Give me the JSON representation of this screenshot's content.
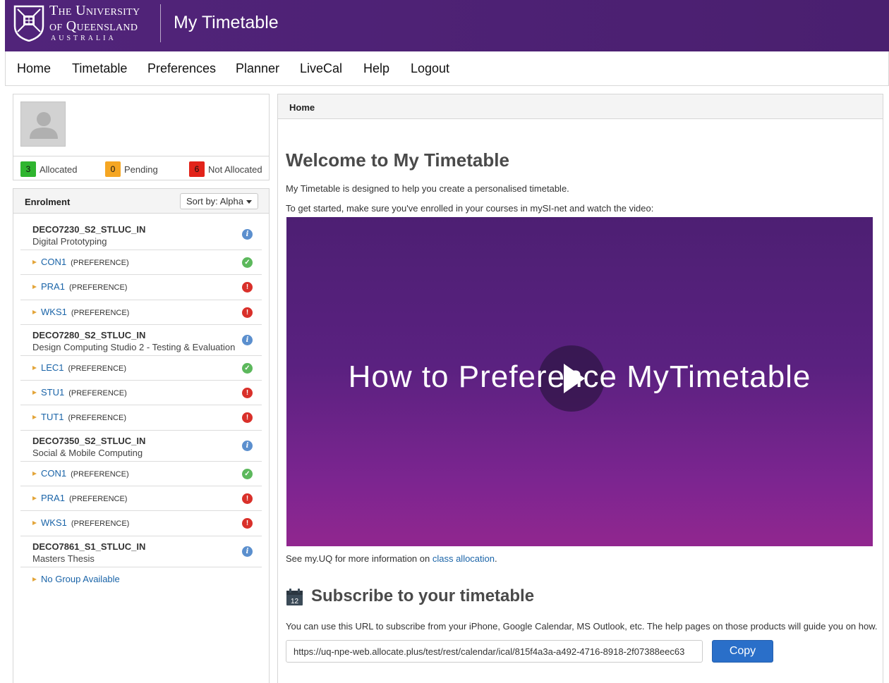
{
  "header": {
    "university_line1": "The University",
    "university_line2": "of Queensland",
    "university_country": "AUSTRALIA",
    "app_title": "My Timetable"
  },
  "nav": {
    "items": [
      "Home",
      "Timetable",
      "Preferences",
      "Planner",
      "LiveCal",
      "Help",
      "Logout"
    ]
  },
  "profile": {
    "stats": [
      {
        "count": "3",
        "label": "Allocated",
        "color": "#2fb52f"
      },
      {
        "count": "0",
        "label": "Pending",
        "color": "#f5a623"
      },
      {
        "count": "6",
        "label": "Not Allocated",
        "color": "#e2231a"
      }
    ]
  },
  "enrolment": {
    "title": "Enrolment",
    "sort_label": "Sort by: Alpha",
    "courses": [
      {
        "code": "DECO7230_S2_STLUC_IN",
        "name": "Digital Prototyping",
        "groups": [
          {
            "code": "CON1",
            "tag": "(PREFERENCE)",
            "status": "ok"
          },
          {
            "code": "PRA1",
            "tag": "(PREFERENCE)",
            "status": "error"
          },
          {
            "code": "WKS1",
            "tag": "(PREFERENCE)",
            "status": "error"
          }
        ]
      },
      {
        "code": "DECO7280_S2_STLUC_IN",
        "name": "Design Computing Studio 2 - Testing & Evaluation",
        "groups": [
          {
            "code": "LEC1",
            "tag": "(PREFERENCE)",
            "status": "ok"
          },
          {
            "code": "STU1",
            "tag": "(PREFERENCE)",
            "status": "error"
          },
          {
            "code": "TUT1",
            "tag": "(PREFERENCE)",
            "status": "error"
          }
        ]
      },
      {
        "code": "DECO7350_S2_STLUC_IN",
        "name": "Social & Mobile Computing",
        "groups": [
          {
            "code": "CON1",
            "tag": "(PREFERENCE)",
            "status": "ok"
          },
          {
            "code": "PRA1",
            "tag": "(PREFERENCE)",
            "status": "error"
          },
          {
            "code": "WKS1",
            "tag": "(PREFERENCE)",
            "status": "error"
          }
        ]
      },
      {
        "code": "DECO7861_S1_STLUC_IN",
        "name": "Masters Thesis",
        "groups": []
      }
    ],
    "no_group": "No Group Available"
  },
  "main": {
    "breadcrumb": "Home",
    "welcome_title": "Welcome to My Timetable",
    "intro_1": "My Timetable is designed to help you create a personalised timetable.",
    "intro_2": "To get started, make sure you've enrolled in your courses in mySI-net and watch the video:",
    "video_title": "How to Preference MyTimetable",
    "see_more_prefix": "See my.UQ for more information on ",
    "see_more_link": "class allocation",
    "see_more_suffix": ".",
    "calendar_day": "12",
    "subscribe_title": "Subscribe to your timetable",
    "subscribe_desc": "You can use this URL to subscribe from your iPhone, Google Calendar, MS Outlook, etc. The help pages on those products will guide you on how.",
    "subscribe_url": "https://uq-npe-web.allocate.plus/test/rest/calendar/ical/815f4a3a-a492-4716-8918-2f07388eec63",
    "copy_label": "Copy"
  }
}
